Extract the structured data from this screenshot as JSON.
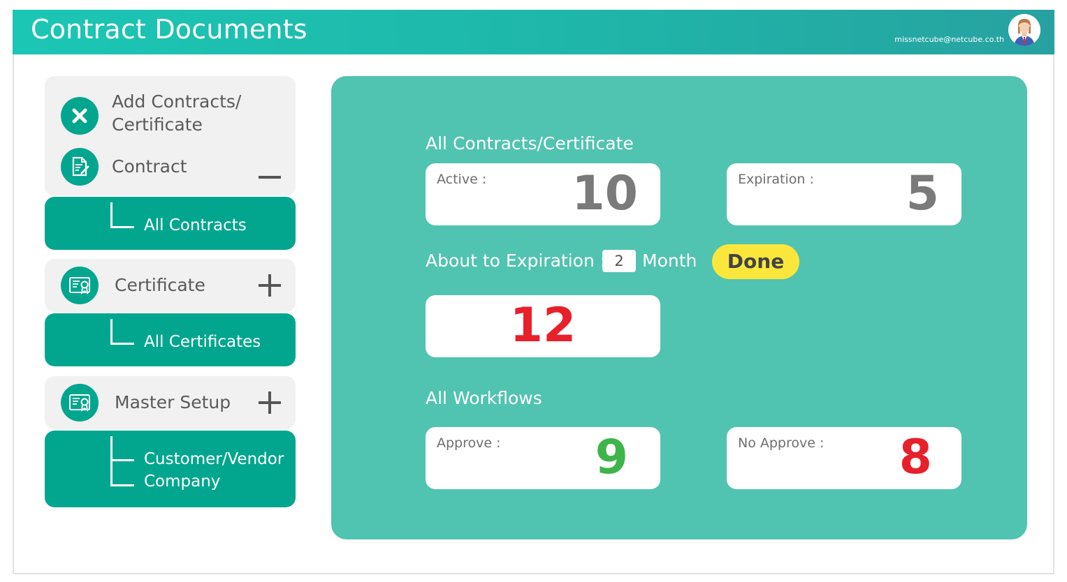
{
  "header": {
    "title": "Contract Documents",
    "user_email": "missnetcube@netcube.co.th"
  },
  "sidebar": {
    "add": {
      "label_line1": "Add Contracts/",
      "label_line2": "Certificate",
      "icon": "close-icon"
    },
    "contract": {
      "label": "Contract",
      "toggle": "collapse",
      "sub_items": [
        {
          "label": "All Contracts"
        }
      ]
    },
    "certificate": {
      "label": "Certificate",
      "toggle": "expand",
      "sub_items": [
        {
          "label": "All Certificates"
        }
      ]
    },
    "master_setup": {
      "label": "Master Setup",
      "toggle": "expand",
      "sub_items": [
        {
          "label_line1": "Customer/Vendor",
          "label_line2": "Company"
        }
      ]
    }
  },
  "dashboard": {
    "all_contracts_title": "All Contracts/Certificate",
    "active": {
      "label": "Active :",
      "value": "10",
      "color": "#7a7a7a"
    },
    "expiration": {
      "label": "Expiration :",
      "value": "5",
      "color": "#7a7a7a"
    },
    "about_to_expire": {
      "label": "About to Expiration :",
      "months": "2",
      "unit": "Month",
      "done_label": "Done",
      "value": "12",
      "color": "#e8202a"
    },
    "workflows_title": "All Workflows",
    "approve": {
      "label": "Approve :",
      "value": "9",
      "color": "#3db54a"
    },
    "no_approve": {
      "label": "No Approve :",
      "value": "8",
      "color": "#e8202a"
    }
  },
  "colors": {
    "header_start": "#1cc6b4",
    "accent": "#02a68f",
    "panel": "#51c3b1",
    "done": "#fbe73c"
  }
}
